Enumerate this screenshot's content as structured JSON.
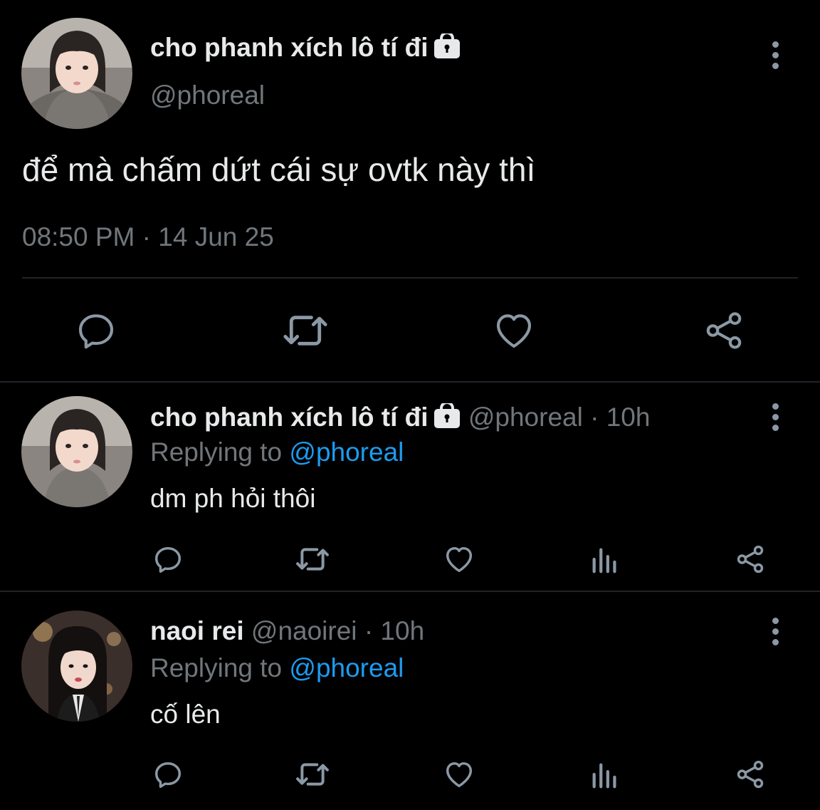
{
  "main_tweet": {
    "display_name": "cho phanh xích lô tí đi",
    "handle": "@phoreal",
    "text": "để mà chấm dứt cái sự ovtk này thì",
    "time": "08:50 PM",
    "separator": "·",
    "date": "14 Jun 25",
    "avatar": "avatar-photo-girl-gray-hoodie",
    "actions": [
      "reply-icon",
      "retweet-icon",
      "like-icon",
      "share-icon"
    ]
  },
  "replies": [
    {
      "display_name": "cho phanh xích lô tí đi",
      "handle": "@phoreal",
      "time_sep": "·",
      "time": "10h",
      "replying_prefix": "Replying to",
      "replying_to": "@phoreal",
      "text": "dm ph hỏi thôi",
      "locked": true,
      "avatar": "avatar-photo-girl-gray-hoodie",
      "actions": [
        "reply-icon",
        "retweet-icon",
        "like-icon",
        "analytics-icon",
        "share-icon"
      ]
    },
    {
      "display_name": "naoi rei",
      "handle": "@naoirei",
      "time_sep": "·",
      "time": "10h",
      "replying_prefix": "Replying to",
      "replying_to": "@phoreal",
      "text": "cố lên",
      "locked": false,
      "avatar": "avatar-photo-girl-black-hair-tie",
      "actions": [
        "reply-icon",
        "retweet-icon",
        "like-icon",
        "analytics-icon",
        "share-icon"
      ]
    }
  ],
  "colors": {
    "background": "#000000",
    "text": "#e7e9ea",
    "muted": "#71767b",
    "link": "#1d9bf0",
    "icon": "#8b98a5",
    "divider": "#202327"
  }
}
